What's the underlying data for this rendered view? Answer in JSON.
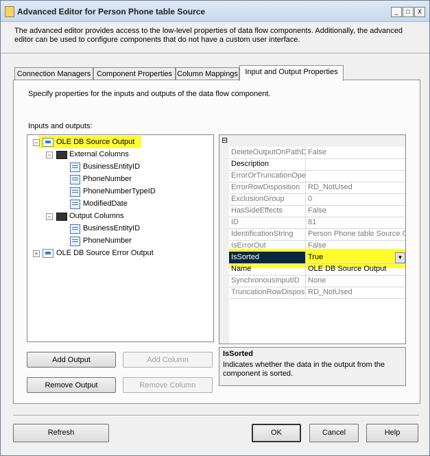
{
  "window": {
    "title": "Advanced Editor for Person Phone table Source",
    "description": "The advanced editor provides access to the low-level properties of data flow components. Additionally, the advanced editor can be used to configure components that do not have a custom user interface."
  },
  "tabs": [
    {
      "label": "Connection Managers"
    },
    {
      "label": "Component Properties"
    },
    {
      "label": "Column Mappings"
    },
    {
      "label": "Input and Output Properties"
    }
  ],
  "panel": {
    "instruction": "Specify properties for the inputs and outputs of the data flow component.",
    "tree_label": "Inputs and outputs:"
  },
  "tree": {
    "output": "OLE DB Source Output",
    "external_group": "External Columns",
    "external_columns": [
      "BusinessEntityID",
      "PhoneNumber",
      "PhoneNumberTypeID",
      "ModifiedDate"
    ],
    "output_group": "Output Columns",
    "output_columns": [
      "BusinessEntityID",
      "PhoneNumber"
    ],
    "error_output": "OLE DB Source Error Output"
  },
  "properties": [
    {
      "name": "DeleteOutputOnPathD",
      "value": "False"
    },
    {
      "name": "Description",
      "value": ""
    },
    {
      "name": "ErrorOrTruncationOpe",
      "value": ""
    },
    {
      "name": "ErrorRowDisposition",
      "value": "RD_NotUsed"
    },
    {
      "name": "ExclusionGroup",
      "value": "0"
    },
    {
      "name": "HasSideEffects",
      "value": "False"
    },
    {
      "name": "ID",
      "value": "81"
    },
    {
      "name": "IdentificationString",
      "value": "Person Phone table Source.O"
    },
    {
      "name": "IsErrorOut",
      "value": "False"
    },
    {
      "name": "IsSorted",
      "value": "True"
    },
    {
      "name": "Name",
      "value": "OLE DB Source Output"
    },
    {
      "name": "SynchronousInputID",
      "value": "None"
    },
    {
      "name": "TruncationRowDisposit",
      "value": "RD_NotUsed"
    }
  ],
  "help": {
    "title": "IsSorted",
    "text": "Indicates whether the data in the output from the component is sorted."
  },
  "buttons": {
    "add_output": "Add Output",
    "add_column": "Add Column",
    "remove_output": "Remove Output",
    "remove_column": "Remove Column",
    "refresh": "Refresh",
    "ok": "OK",
    "cancel": "Cancel",
    "help": "Help"
  },
  "glyphs": {
    "minimize": "_",
    "maximize": "□",
    "close": "X",
    "collapse": "−",
    "expand": "+",
    "categorized": "⊟",
    "dropdown": "▼"
  },
  "colors": {
    "highlight": "#fffb2a",
    "selected_row": "#0b2740"
  }
}
